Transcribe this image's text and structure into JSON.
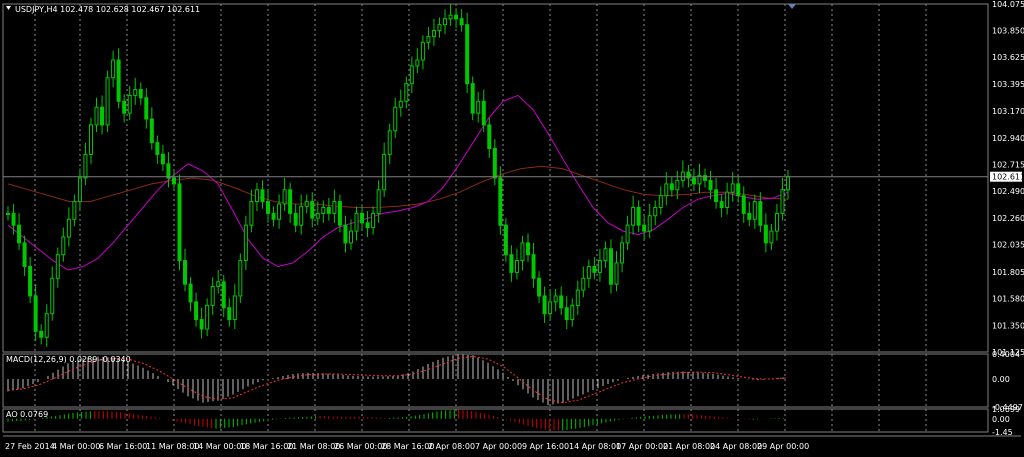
{
  "colors": {
    "background": "#000000",
    "grid": "#ffffff",
    "candle_up": "#00c800",
    "candle_down": "#00c800",
    "ma_fast": "#c800c8",
    "ma_slow": "#8b2a1a",
    "current_price_line": "#808080",
    "macd_hist": "#c0c0c0",
    "macd_signal": "#ff3030",
    "ao_up": "#00c000",
    "ao_down": "#d00000",
    "text": "#ffffff"
  },
  "header": {
    "dropdown_icon": "triangle-down-icon",
    "symbol_line": "USDJPY,H4  102.478 102.628 102.467 102.611"
  },
  "macd_panel": {
    "label": "MACD(12,26,9) 0.0289 -0.0340"
  },
  "ao_panel": {
    "label": "AO 0.0769"
  },
  "chart_data": [
    {
      "type": "line",
      "title": "USDJPY,H4",
      "ohlc_last": {
        "open": 102.478,
        "high": 102.628,
        "low": 102.467,
        "close": 102.611
      },
      "current_price": 102.611,
      "ylim": [
        101.125,
        104.075
      ],
      "yticks": [
        "104.075",
        "103.850",
        "103.625",
        "103.395",
        "103.170",
        "102.940",
        "102.715",
        "102.490",
        "102.260",
        "102.035",
        "101.805",
        "101.580",
        "101.350",
        "101.125"
      ],
      "x_labels": [
        "27 Feb 2014",
        "4 Mar 00:00",
        "6 Mar 16:00",
        "11 Mar 08:00",
        "14 Mar 00:00",
        "18 Mar 16:00",
        "21 Mar 08:00",
        "26 Mar 00:00",
        "28 Mar 16:00",
        "2 Apr 08:00",
        "7 Apr 00:00",
        "9 Apr 16:00",
        "14 Apr 08:00",
        "17 Apr 00:00",
        "21 Apr 08:00",
        "24 Apr 08:00",
        "29 Apr 00:00"
      ],
      "grid": true,
      "series": [
        {
          "values": [
            102.3,
            102.2,
            102.05,
            101.85,
            101.6,
            101.3,
            101.25,
            101.45,
            101.75,
            101.95,
            102.1,
            102.25,
            102.4,
            102.6,
            102.8,
            103.05,
            103.2,
            103.05,
            103.45,
            103.6,
            103.25,
            103.15,
            103.3,
            103.35,
            103.28,
            103.1,
            102.9,
            102.8,
            102.72,
            102.6,
            102.55,
            101.9,
            101.7,
            101.55,
            101.4,
            101.32,
            101.52,
            101.68,
            101.72,
            101.5,
            101.4,
            101.6,
            101.9,
            102.2,
            102.4,
            102.5,
            102.4,
            102.3,
            102.25,
            102.38,
            102.5,
            102.3,
            102.2,
            102.36,
            102.4,
            102.26,
            102.3,
            102.35,
            102.3,
            102.4,
            102.2,
            102.05,
            102.15,
            102.3,
            102.22,
            102.18,
            102.3,
            102.5,
            102.8,
            103.0,
            103.2,
            103.25,
            103.4,
            103.55,
            103.6,
            103.75,
            103.8,
            103.85,
            103.9,
            103.95,
            103.98,
            103.95,
            103.9,
            103.4,
            103.15,
            103.25,
            103.05,
            102.85,
            102.6,
            102.2,
            101.95,
            101.8,
            101.9,
            102.05,
            101.95,
            101.75,
            101.6,
            101.45,
            101.55,
            101.6,
            101.5,
            101.4,
            101.52,
            101.65,
            101.75,
            101.85,
            101.8,
            101.9,
            102.0,
            101.7,
            101.88,
            102.05,
            102.2,
            102.35,
            102.2,
            102.15,
            102.28,
            102.35,
            102.45,
            102.55,
            102.5,
            102.58,
            102.65,
            102.6,
            102.55,
            102.62,
            102.58,
            102.5,
            102.4,
            102.35,
            102.48,
            102.55,
            102.45,
            102.3,
            102.25,
            102.4,
            102.2,
            102.05,
            102.15,
            102.3,
            102.5,
            102.61
          ]
        },
        {
          "name": "",
          "values": [
            102.2,
            102.1,
            102.0,
            101.9,
            101.82,
            101.85,
            101.92,
            102.05,
            102.2,
            102.35,
            102.5,
            102.62,
            102.72,
            102.66,
            102.55,
            102.32,
            102.08,
            101.92,
            101.85,
            101.88,
            101.98,
            102.1,
            102.18,
            102.22,
            102.26,
            102.3,
            102.32,
            102.35,
            102.4,
            102.52,
            102.7,
            102.9,
            103.1,
            103.25,
            103.3,
            103.18,
            102.98,
            102.76,
            102.55,
            102.35,
            102.22,
            102.15,
            102.12,
            102.16,
            102.25,
            102.35,
            102.42,
            102.45,
            102.47,
            102.44,
            102.42,
            102.43,
            102.48
          ]
        },
        {
          "name": "",
          "values": [
            102.55,
            102.5,
            102.45,
            102.4,
            102.4,
            102.45,
            102.5,
            102.55,
            102.58,
            102.6,
            102.58,
            102.52,
            102.45,
            102.4,
            102.38,
            102.38,
            102.36,
            102.35,
            102.35,
            102.36,
            102.38,
            102.42,
            102.48,
            102.56,
            102.63,
            102.68,
            102.7,
            102.68,
            102.62,
            102.56,
            102.5,
            102.46,
            102.45,
            102.46,
            102.48,
            102.48,
            102.46,
            102.43,
            102.42
          ]
        }
      ]
    },
    {
      "type": "bar",
      "title": "MACD(12,26,9)",
      "ylim": [
        -0.4497,
        0.4004
      ],
      "yticks": [
        "0.4004",
        "0.00",
        "-0.4497"
      ],
      "series": [
        {
          "values": [
            -0.2,
            -0.15,
            -0.05,
            0.1,
            0.25,
            0.33,
            0.36,
            0.34,
            0.28,
            0.18,
            0.05,
            -0.1,
            -0.28,
            -0.38,
            -0.35,
            -0.25,
            -0.12,
            -0.02,
            0.03,
            0.08,
            0.1,
            0.09,
            0.07,
            0.05,
            0.04,
            0.04,
            0.05,
            0.12,
            0.24,
            0.34,
            0.4,
            0.38,
            0.26,
            0.1,
            -0.1,
            -0.3,
            -0.42,
            -0.38,
            -0.28,
            -0.18,
            -0.08,
            0.0,
            0.05,
            0.08,
            0.11,
            0.12,
            0.11,
            0.08,
            0.04,
            0.0,
            -0.02,
            0.01,
            0.03
          ]
        },
        {
          "values": [
            -0.18,
            -0.16,
            -0.1,
            0.0,
            0.12,
            0.22,
            0.3,
            0.33,
            0.32,
            0.25,
            0.14,
            0.0,
            -0.15,
            -0.28,
            -0.33,
            -0.3,
            -0.2,
            -0.1,
            -0.02,
            0.03,
            0.07,
            0.08,
            0.08,
            0.07,
            0.06,
            0.05,
            0.05,
            0.08,
            0.15,
            0.24,
            0.33,
            0.36,
            0.32,
            0.2,
            0.02,
            -0.18,
            -0.33,
            -0.38,
            -0.34,
            -0.25,
            -0.15,
            -0.06,
            0.0,
            0.05,
            0.08,
            0.1,
            0.11,
            0.1,
            0.07,
            0.03,
            0.0,
            0.0,
            0.02
          ]
        }
      ]
    },
    {
      "type": "bar",
      "title": "AO",
      "ylim": [
        -1.45,
        1.0699
      ],
      "yticks": [
        "1.0699",
        "0.00",
        "-1.45"
      ],
      "series": [
        {
          "values": [
            -0.3,
            -0.2,
            0.1,
            0.4,
            0.7,
            0.85,
            0.8,
            0.6,
            0.3,
            0.0,
            -0.4,
            -0.8,
            -1.1,
            -0.9,
            -0.5,
            -0.2,
            0.1,
            0.2,
            0.3,
            0.25,
            0.2,
            0.15,
            0.1,
            0.2,
            0.5,
            0.9,
            1.0,
            0.8,
            0.3,
            -0.2,
            -0.8,
            -1.2,
            -1.3,
            -1.0,
            -0.6,
            -0.2,
            0.1,
            0.3,
            0.45,
            0.5,
            0.4,
            0.2,
            0.0,
            -0.1,
            0.05,
            0.08
          ]
        }
      ]
    }
  ]
}
